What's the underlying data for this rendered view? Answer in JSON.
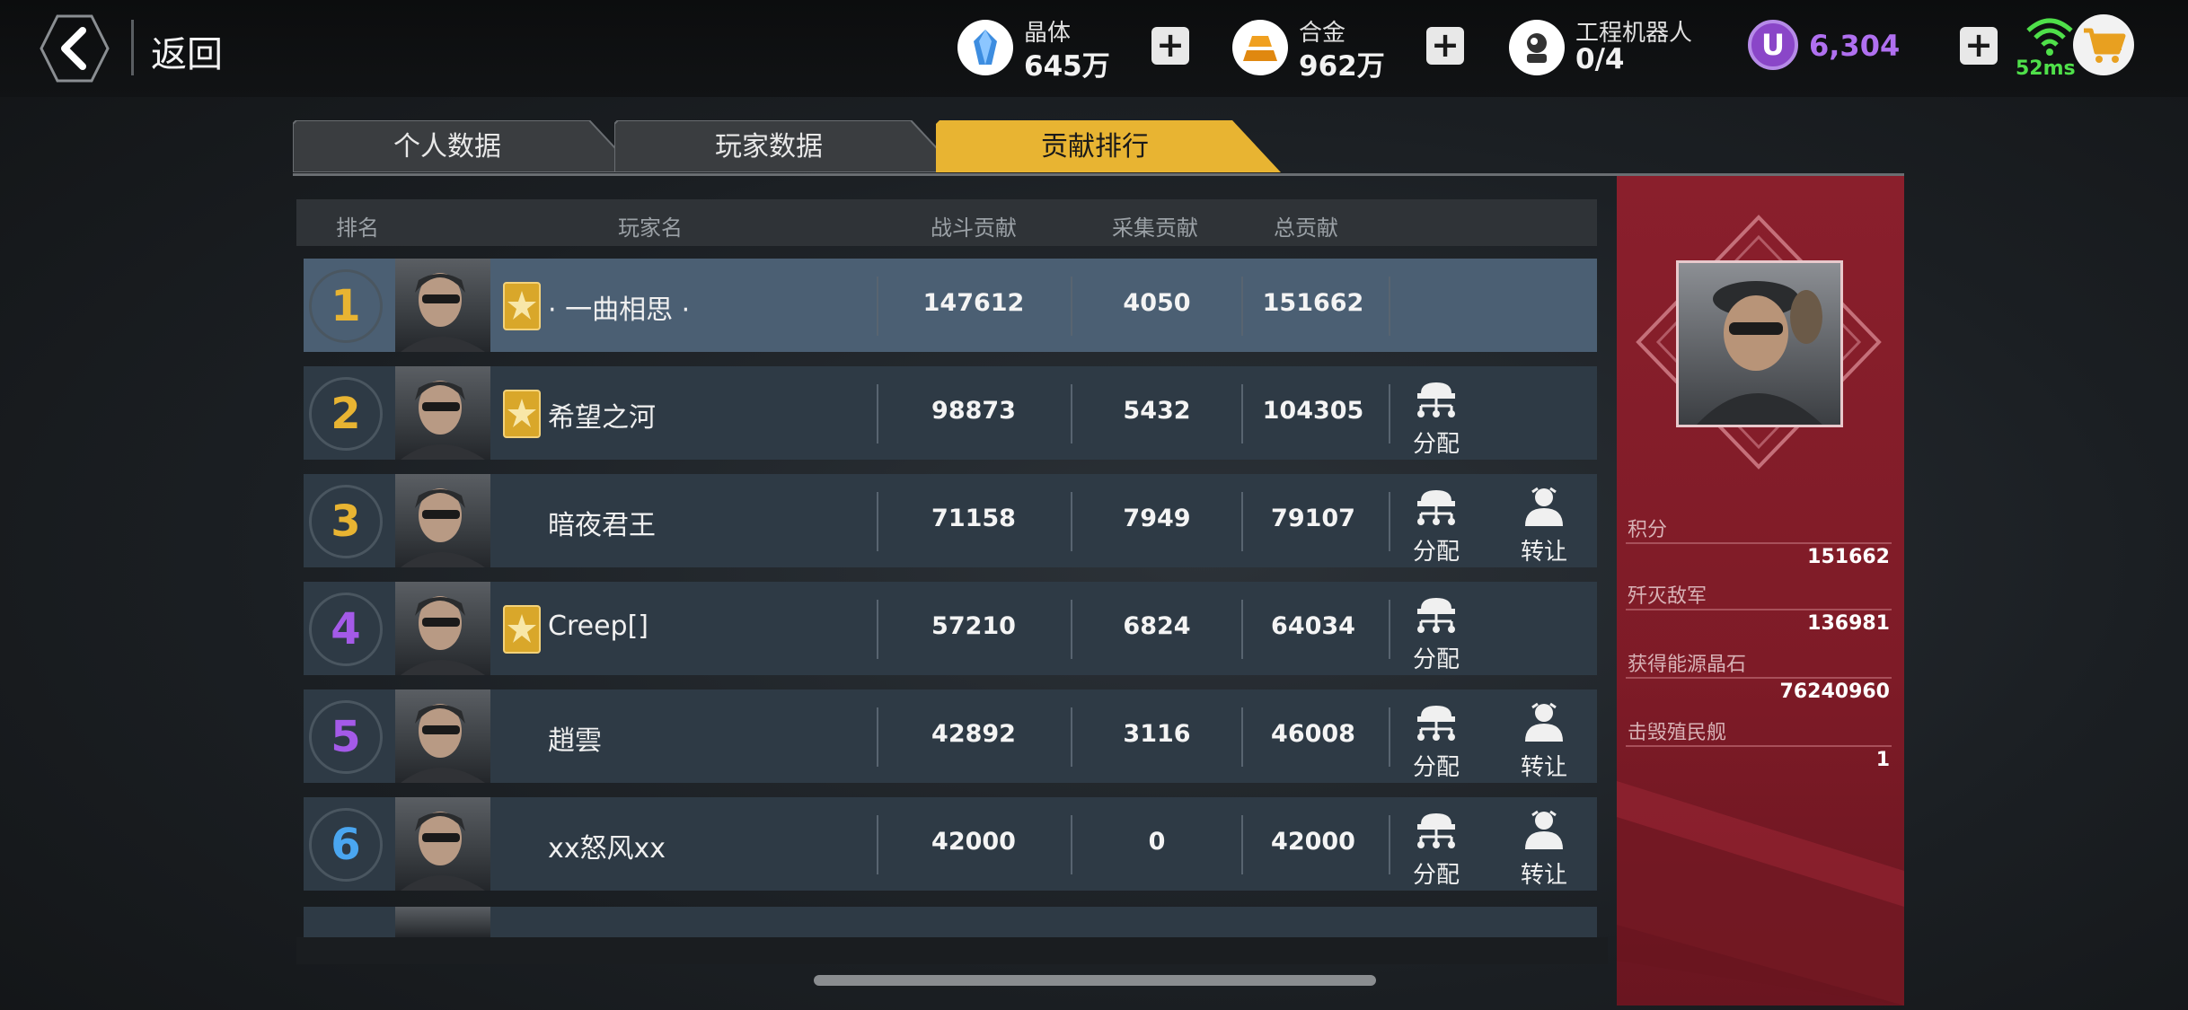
{
  "header": {
    "back_label": "返回",
    "resources": [
      {
        "name": "晶体",
        "value": "645万",
        "icon": "crystal-icon"
      },
      {
        "name": "合金",
        "value": "962万",
        "icon": "alloy-icon"
      },
      {
        "name": "工程机器人",
        "value": "0/4",
        "icon": "robot-icon"
      }
    ],
    "premium_currency": {
      "symbol": "U",
      "value": "6,304"
    },
    "ping": "52ms"
  },
  "tabs": [
    {
      "label": "个人数据",
      "active": false
    },
    {
      "label": "玩家数据",
      "active": false
    },
    {
      "label": "贡献排行",
      "active": true
    }
  ],
  "table": {
    "columns": [
      "排名",
      "玩家名",
      "战斗贡献",
      "采集贡献",
      "总贡献"
    ],
    "rows": [
      {
        "rank": "1",
        "name": "· 一曲相思 ·",
        "badge": true,
        "combat": "147612",
        "gather": "4050",
        "total": "151662",
        "assign": "",
        "transfer": ""
      },
      {
        "rank": "2",
        "name": "希望之河",
        "badge": true,
        "combat": "98873",
        "gather": "5432",
        "total": "104305",
        "assign": "分配",
        "transfer": ""
      },
      {
        "rank": "3",
        "name": "暗夜君王",
        "badge": false,
        "combat": "71158",
        "gather": "7949",
        "total": "79107",
        "assign": "分配",
        "transfer": "转让"
      },
      {
        "rank": "4",
        "name": "Creep[]",
        "badge": true,
        "combat": "57210",
        "gather": "6824",
        "total": "64034",
        "assign": "分配",
        "transfer": ""
      },
      {
        "rank": "5",
        "name": "趙雲",
        "badge": false,
        "combat": "42892",
        "gather": "3116",
        "total": "46008",
        "assign": "分配",
        "transfer": "转让"
      },
      {
        "rank": "6",
        "name": "xx怒风xx",
        "badge": false,
        "combat": "42000",
        "gather": "0",
        "total": "42000",
        "assign": "分配",
        "transfer": "转让"
      }
    ]
  },
  "side_panel": {
    "stats": [
      {
        "label": "积分",
        "value": "151662"
      },
      {
        "label": "歼灭敌军",
        "value": "136981"
      },
      {
        "label": "获得能源晶石",
        "value": "76240960"
      },
      {
        "label": "击毁殖民舰",
        "value": "1"
      }
    ]
  },
  "colors": {
    "rank_gold": "#e8b432",
    "rank_purple": "#a45ae8",
    "rank_blue": "#4aa6f0",
    "tab_active": "#e8b432",
    "panel_red": "#8a1f2c"
  }
}
